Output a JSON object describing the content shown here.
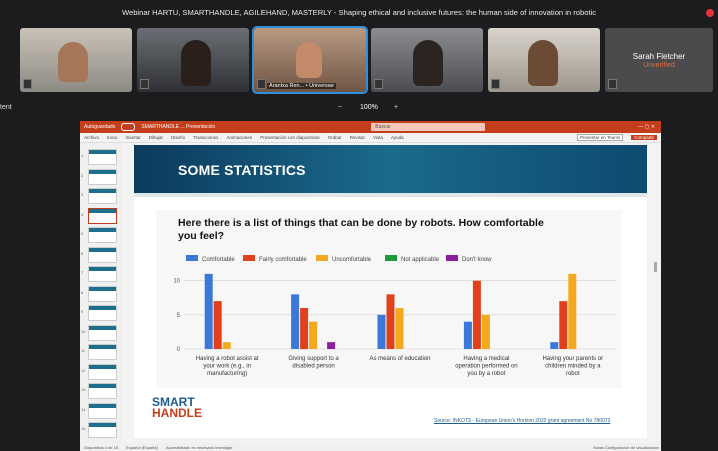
{
  "meeting": {
    "title": "Webinar HARTU, SMARTHANDLE, AGILEHAND, MASTERLY - Shaping ethical and inclusive futures: the human side of innovation in robotic",
    "side_label": "tent",
    "zoom": {
      "minus": "−",
      "value": "100%",
      "plus": "+"
    },
    "participants": [
      {
        "name": ""
      },
      {
        "name": ""
      },
      {
        "name": "Arantxa Ren... • Universae"
      },
      {
        "name": ""
      },
      {
        "name": ""
      },
      {
        "name": "Sarah Fletcher",
        "status": "Unverified"
      }
    ]
  },
  "ppt": {
    "titlebar": {
      "autosave": "Autoguardado",
      "filename": "SMARTHANDLE ... Presentación",
      "search": "Buscar"
    },
    "ribbon": {
      "tabs": [
        "Archivo",
        "Inicio",
        "Insertar",
        "Dibujar",
        "Diseño",
        "Transiciones",
        "Animaciones",
        "Presentación con diapositivas",
        "Grabar",
        "Revisar",
        "Vista",
        "Ayuda"
      ],
      "present_label": "Presentar en Teams",
      "share_label": "Compartir"
    },
    "thumb_numbers": [
      "1",
      "2",
      "3",
      "4",
      "5",
      "6",
      "7",
      "8",
      "9",
      "10",
      "11",
      "12",
      "13",
      "14",
      "15"
    ],
    "statusbar": {
      "left": "Diapositiva 4 de 15",
      "lang": "Español (España)",
      "access": "Accesibilidad: es necesario investigar",
      "right": "Notas   Configuración de visualización"
    }
  },
  "slide": {
    "heading": "SOME STATISTICS",
    "logo_line1": "SMART",
    "logo_line2": "HANDLE",
    "source": "Source: INKOTS - European Union's Horizon 2020 grant agreement No 780073"
  },
  "chart_data": {
    "type": "bar",
    "title": "Here there is a list of things that can be done by robots. How comfortable you feel?",
    "categories": [
      "Having a robot assist at your work (e.g., in manufacturing)",
      "Giving support to a disabled person",
      "As means of education",
      "Having a medical operation performed on you by a robot",
      "Having your parents or children minded by a robot"
    ],
    "series": [
      {
        "name": "Comfortable",
        "color": "#3c78d8",
        "values": [
          11,
          8,
          5,
          4,
          1
        ]
      },
      {
        "name": "Fairly comfortable",
        "color": "#e0401c",
        "values": [
          7,
          6,
          8,
          10,
          7
        ]
      },
      {
        "name": "Uncomfortable",
        "color": "#f4a81d",
        "values": [
          1,
          4,
          6,
          5,
          11
        ]
      },
      {
        "name": "Not applicable",
        "color": "#1e9a3a",
        "values": [
          0,
          0,
          0,
          0,
          0
        ]
      },
      {
        "name": "Don't know",
        "color": "#8e1d9e",
        "values": [
          0,
          1,
          0,
          0,
          0
        ]
      }
    ],
    "yticks": [
      "0",
      "5",
      "10"
    ],
    "ylim": [
      0,
      12
    ],
    "legend": "top",
    "grid": true
  }
}
